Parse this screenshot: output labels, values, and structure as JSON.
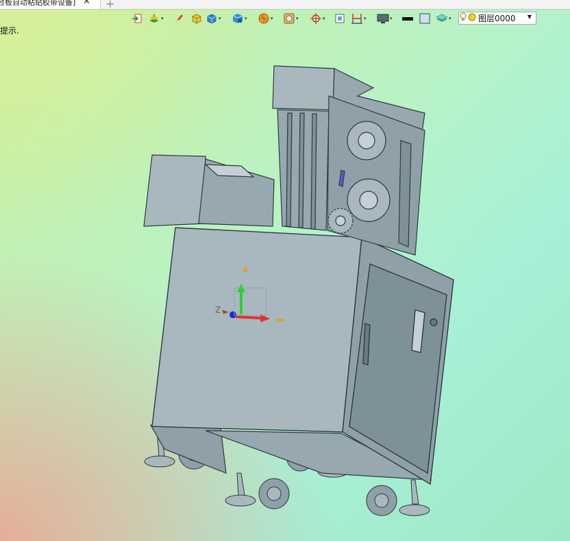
{
  "tab": {
    "title": "台板自动粘贴胶带设备]",
    "close_glyph": "✕",
    "new_tab_glyph": "+"
  },
  "hint_text": "提示.",
  "toolbar": {
    "layer_label": "图层0000",
    "dropdown_glyph": "▾",
    "layer_dropdown_glyph": "▼"
  },
  "triad": {
    "z_label": "Z"
  },
  "colors": {
    "model_fill": "#a9b8bf",
    "model_dark": "#8fa0a8",
    "model_edge": "#2c3a40",
    "axis_x": "#e8322b",
    "axis_y": "#2bd12b",
    "axis_z": "#1a2ad6"
  }
}
